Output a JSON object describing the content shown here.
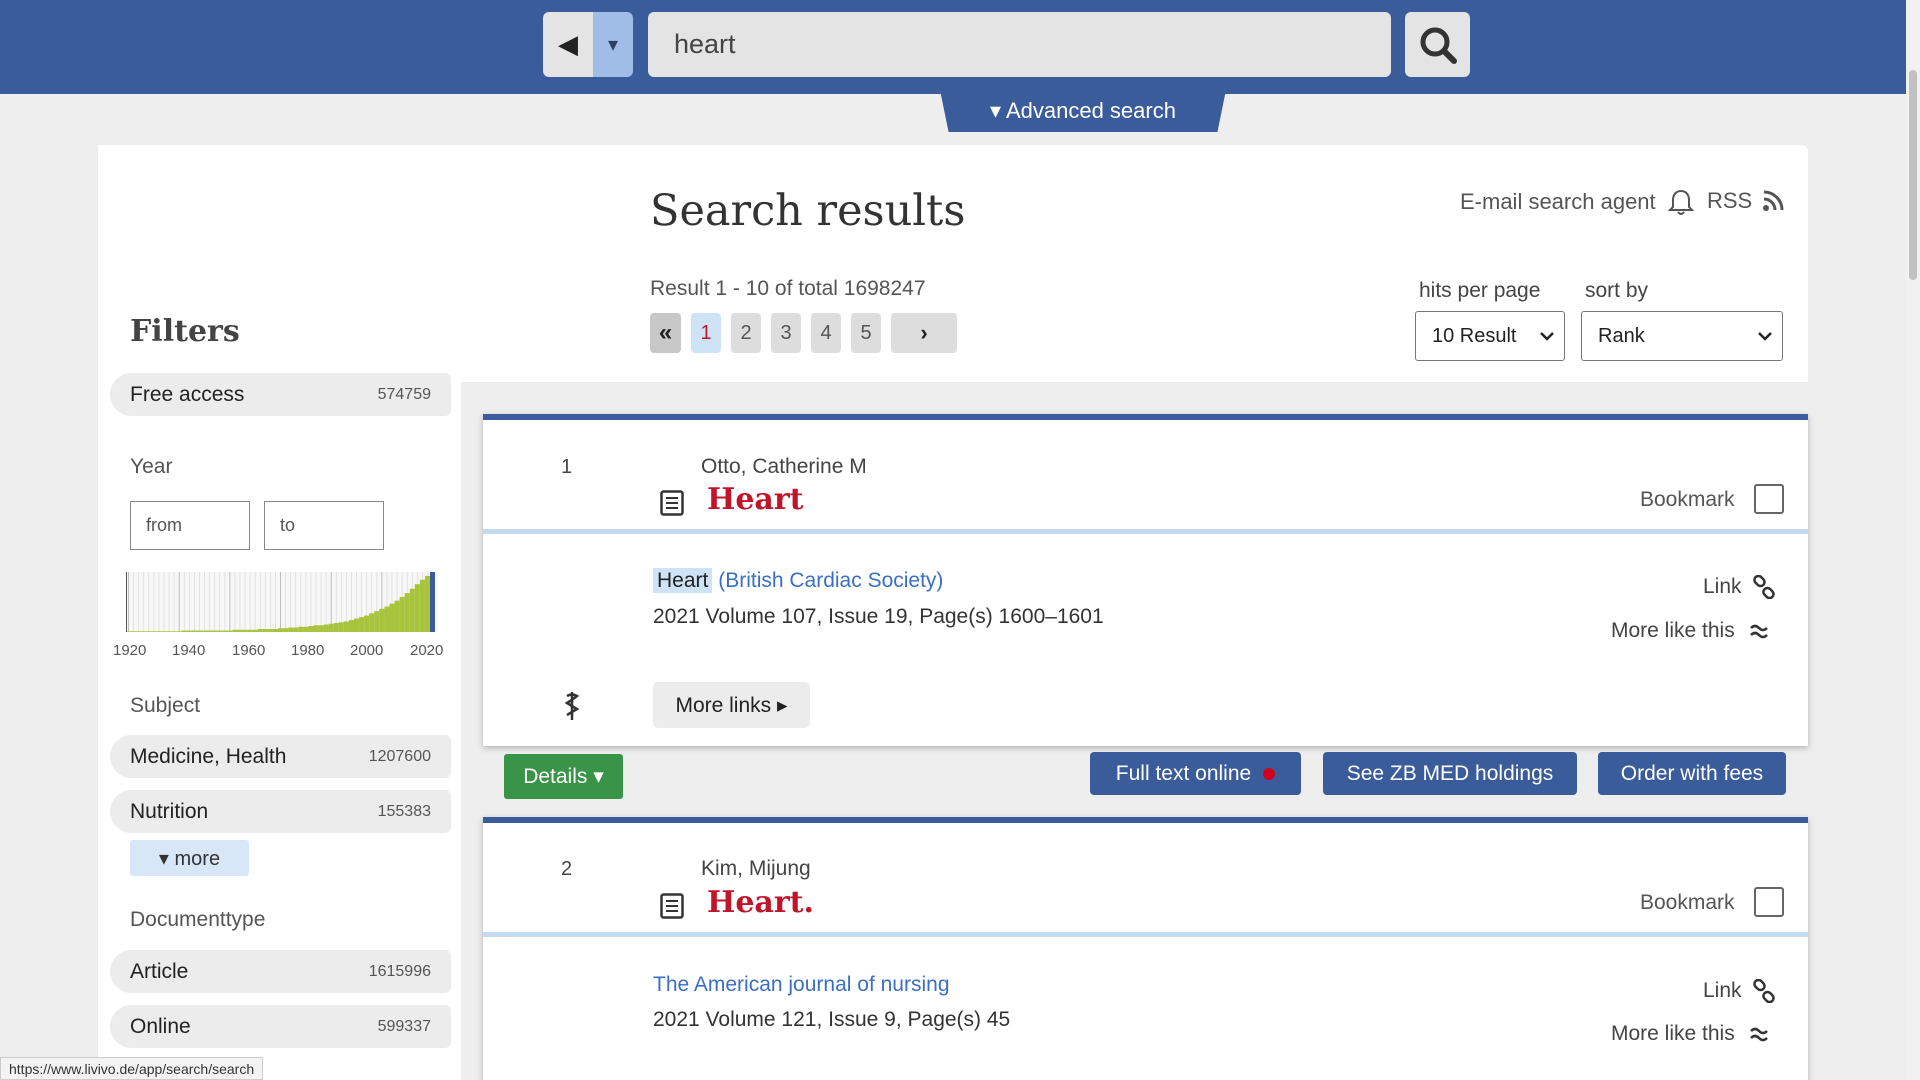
{
  "search": {
    "value": "heart",
    "advanced_label": "▾ Advanced search"
  },
  "header": {
    "title": "Search results",
    "email_agent": "E-mail search agent",
    "rss": "RSS",
    "result_count": "Result 1 - 10 of total 1698247",
    "pages": [
      "1",
      "2",
      "3",
      "4",
      "5"
    ],
    "hits_label": "hits per page",
    "hits_value": "10 Result",
    "sort_label": "sort by",
    "sort_value": "Rank"
  },
  "filters": {
    "title": "Filters",
    "free_access": {
      "label": "Free access",
      "count": "574759"
    },
    "year_label": "Year",
    "year_from": "from",
    "year_to": "to",
    "year_ticks": [
      "1920",
      "1940",
      "1960",
      "1980",
      "2000",
      "2020"
    ],
    "subject_label": "Subject",
    "subjects": [
      {
        "label": "Medicine, Health",
        "count": "1207600"
      },
      {
        "label": "Nutrition",
        "count": "155383"
      }
    ],
    "more_label": "▾ more",
    "doctype_label": "Documenttype",
    "doctypes": [
      {
        "label": "Article",
        "count": "1615996"
      },
      {
        "label": "Online",
        "count": "599337"
      }
    ]
  },
  "results": [
    {
      "number": "1",
      "author": "Otto, Catherine M",
      "title": "Heart",
      "bookmark": "Bookmark",
      "journal_highlight": "Heart",
      "journal_rest": "(British Cardiac Society)",
      "meta": "2021  Volume 107, Issue 19, Page(s) 1600–1601",
      "link": "Link",
      "more_like": "More like this",
      "more_links": "More links ▸"
    },
    {
      "number": "2",
      "author": "Kim, Mijung",
      "title": "Heart.",
      "bookmark": "Bookmark",
      "journal": "The American journal of nursing",
      "meta": "2021  Volume 121, Issue 9, Page(s) 45",
      "link": "Link",
      "more_like": "More like this"
    }
  ],
  "actions": {
    "details": "Details ▾",
    "full_text": "Full text online",
    "zb_med": "See ZB MED holdings",
    "order": "Order with fees"
  },
  "status_url": "https://www.livivo.de/app/search/search",
  "colors": {
    "brand": "#3a5c9a",
    "title_red": "#c0142a",
    "details_green": "#3a9448",
    "link_blue": "#3a6fc4"
  },
  "histogram": [
    1,
    1,
    1,
    1,
    1,
    1,
    1,
    1,
    1,
    1,
    1,
    2,
    2,
    2,
    2,
    2,
    2,
    2,
    2,
    2,
    2,
    3,
    3,
    3,
    3,
    3,
    4,
    4,
    4,
    4,
    5,
    5,
    6,
    6,
    7,
    7,
    8,
    9,
    9,
    10,
    11,
    12,
    13,
    14,
    16,
    18,
    20,
    22,
    25,
    28,
    31,
    34,
    38,
    42,
    47,
    52,
    58,
    64,
    70,
    75
  ]
}
